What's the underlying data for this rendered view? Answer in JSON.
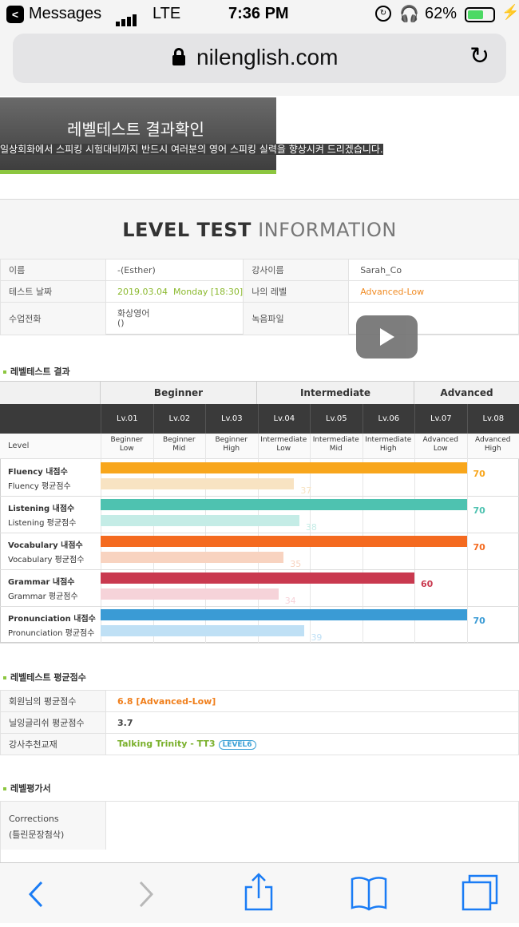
{
  "status_bar": {
    "back_glyph": "<",
    "app": "Messages",
    "network": "LTE",
    "time": "7:36 PM",
    "battery": "62%",
    "battery_level": 0.62
  },
  "browser": {
    "url": "nilenglish.com"
  },
  "hero": {
    "title": "레벨테스트 결과확인",
    "subtitle": "일상회화에서 스피킹 시험대비까지 반드시 여러분의 영어 스피킹 실력을 향상시켜 드리겠습니다."
  },
  "info": {
    "heading_bold": "LEVEL TEST",
    "heading_light": "INFORMATION",
    "name_label": "이름",
    "name_value": "-(Esther)",
    "teacher_label": "강사이름",
    "teacher_value": "Sarah_Co",
    "date_label": "테스트 날짜",
    "date_value": "2019.03.04  Monday [18:30]",
    "mylevel_label": "나의 레벨",
    "mylevel_value": "Advanced-Low",
    "class_label": "수업전화",
    "class_value1": "화상영어",
    "class_value2": "()",
    "recording_label": "녹음파일"
  },
  "result": {
    "section_title": "레벨테스트 결과",
    "groups": [
      "Beginner",
      "Intermediate",
      "Advanced"
    ],
    "levels": [
      "Lv.01",
      "Lv.02",
      "Lv.03",
      "Lv.04",
      "Lv.05",
      "Lv.06",
      "Lv.07",
      "Lv.08"
    ],
    "level_row_label": "Level",
    "level_desc": [
      [
        "Beginner",
        "Low"
      ],
      [
        "Beginner",
        "Mid"
      ],
      [
        "Beginner",
        "High"
      ],
      [
        "Intermediate",
        "Low"
      ],
      [
        "Intermediate",
        "Mid"
      ],
      [
        "Intermediate",
        "High"
      ],
      [
        "Advanced",
        "Low"
      ],
      [
        "Advanced",
        "High"
      ]
    ],
    "scores": [
      {
        "my_label": "Fluency 내점수",
        "avg_label": "Fluency 평균점수",
        "my": 70,
        "avg": 37,
        "my_color": "#f8a61c",
        "avg_color": "#f8e3c2"
      },
      {
        "my_label": "Listening 내점수",
        "avg_label": "Listening 평균점수",
        "my": 70,
        "avg": 38,
        "my_color": "#4ec2b0",
        "avg_color": "#c4ece6"
      },
      {
        "my_label": "Vocabulary 내점수",
        "avg_label": "Vocabulary 평균점수",
        "my": 70,
        "avg": 35,
        "my_color": "#f46a1f",
        "avg_color": "#f8d3c0"
      },
      {
        "my_label": "Grammar 내점수",
        "avg_label": "Grammar 평균점수",
        "my": 60,
        "avg": 34,
        "my_color": "#c9394f",
        "avg_color": "#f6d3d9"
      },
      {
        "my_label": "Pronunciation 내점수",
        "avg_label": "Pronunciation 평균점수",
        "my": 70,
        "avg": 39,
        "my_color": "#3a9bd5",
        "avg_color": "#bfe0f5"
      }
    ],
    "scale_max": 80
  },
  "average": {
    "section_title": "레벨테스트 평균점수",
    "member_label": "회원님의 평균점수",
    "member_value": "6.8 [Advanced-Low]",
    "nil_label": "닐잉글리쉬 평균점수",
    "nil_value": "3.7",
    "book_label": "강사추천교재",
    "book_value": "Talking Trinity - TT3",
    "book_badge": "LEVEL6"
  },
  "evaluation": {
    "section_title": "레벨평가서",
    "corrections_label": "Corrections",
    "corrections_sub": "(틀린문장첨삭)"
  },
  "toolbar": {
    "back": "back-icon",
    "forward": "forward-icon",
    "share": "share-icon",
    "bookmarks": "bookmarks-icon",
    "tabs": "tabs-icon"
  }
}
